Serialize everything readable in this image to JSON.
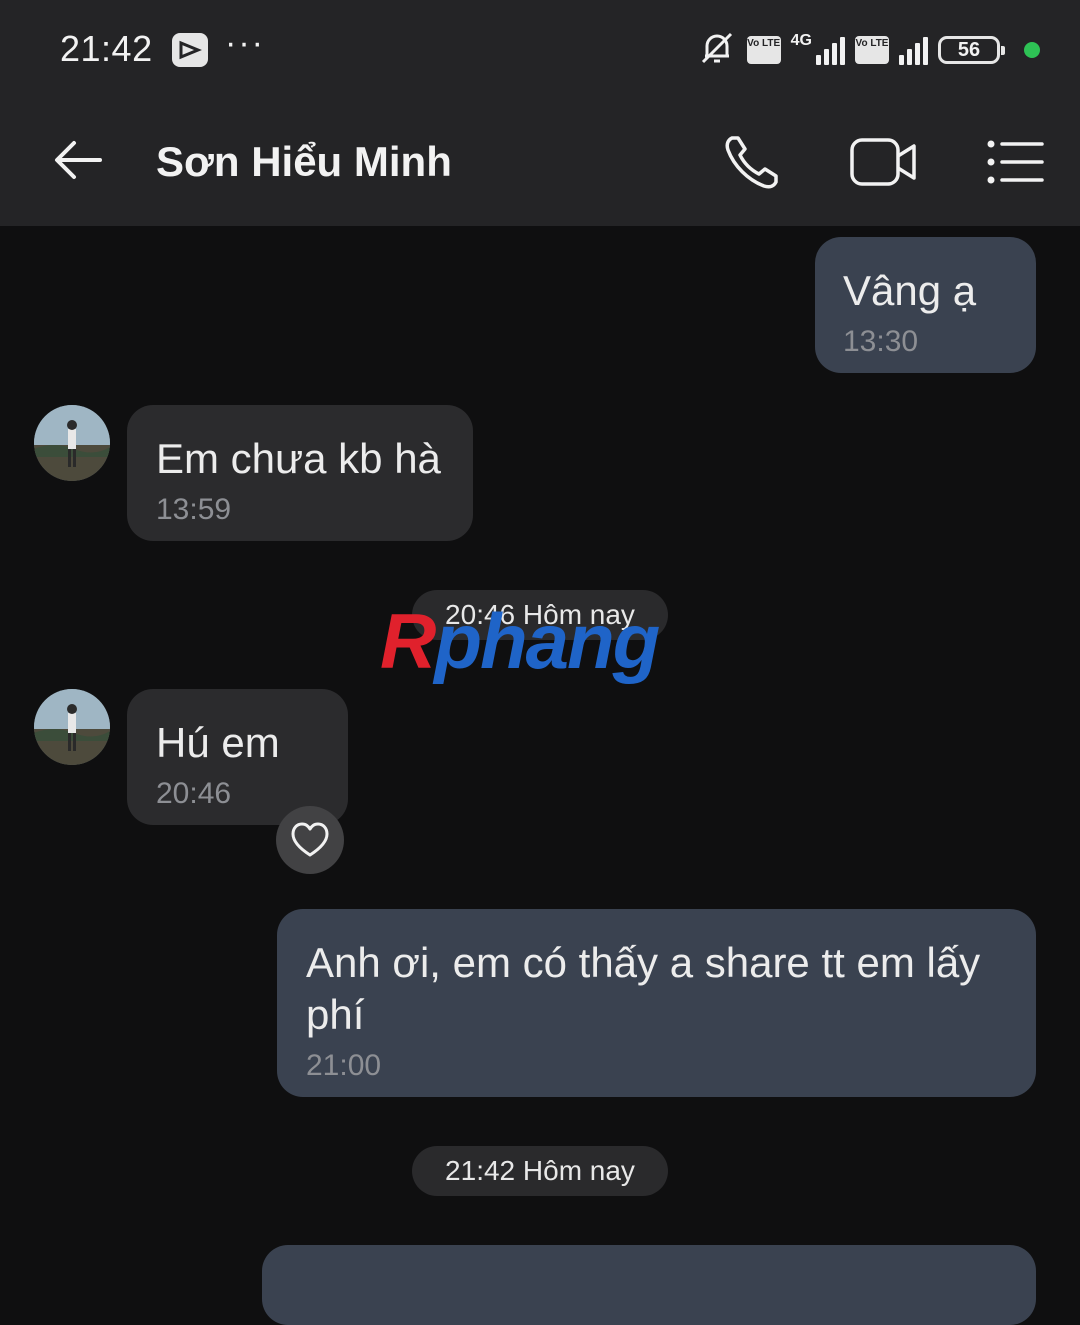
{
  "status_bar": {
    "time": "21:42",
    "battery": "56",
    "network": "4G",
    "volte1": "Vo LTE",
    "volte2": "Vo LTE",
    "more": "···",
    "icons": [
      "app-icon",
      "more-icon",
      "mute-bell-icon",
      "volte-icon",
      "signal-icon",
      "volte-icon",
      "signal-icon",
      "battery-icon",
      "status-dot"
    ]
  },
  "header": {
    "contact_name": "Sơn Hiểu Minh",
    "icons": [
      "back-arrow-icon",
      "phone-icon",
      "video-camera-icon",
      "menu-list-icon"
    ]
  },
  "messages": [
    {
      "direction": "out",
      "text": "Vâng ạ",
      "time": "13:30"
    },
    {
      "direction": "in",
      "text": "Em chưa kb hà",
      "time": "13:59"
    },
    {
      "divider": "20:46 Hôm nay"
    },
    {
      "direction": "in",
      "text": "Hú em",
      "time": "20:46",
      "reaction": "heart-icon"
    },
    {
      "direction": "out",
      "text": "Anh ơi, em có thấy a share tt em lấy phí",
      "time": "21:00"
    },
    {
      "divider": "21:42 Hôm nay"
    }
  ],
  "watermark": {
    "text_red": "R",
    "text_blue": "phang",
    "colors": {
      "red": "#e0212c",
      "blue": "#1f64c8",
      "cyan": "#2aa6d8"
    }
  },
  "colors": {
    "background": "#0f0f10",
    "bar": "#242426",
    "incoming": "#2b2b2d",
    "outgoing": "#3a4250",
    "status_dot": "#2ec255"
  }
}
